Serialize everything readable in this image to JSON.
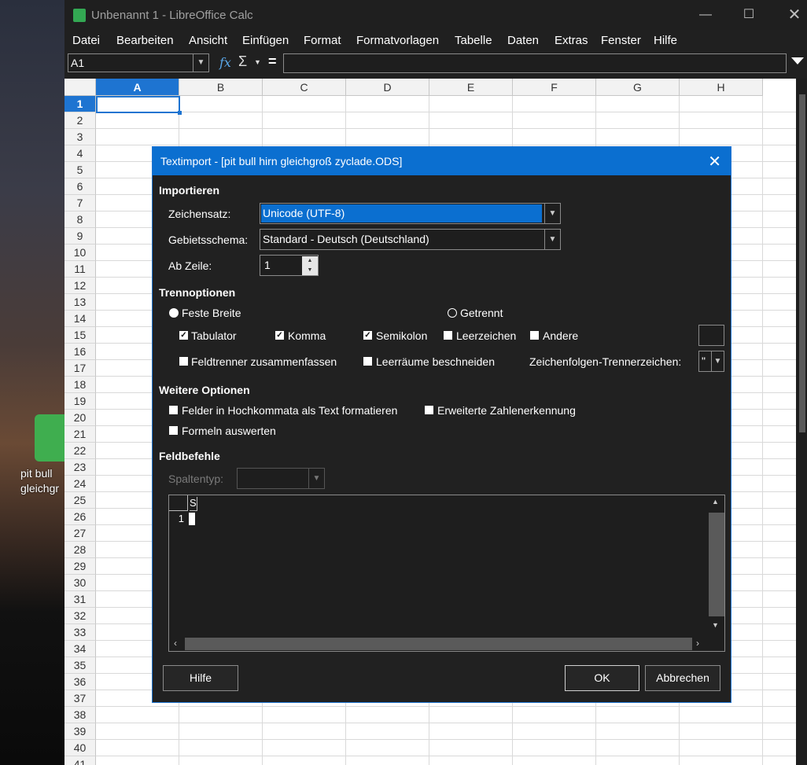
{
  "desktop": {
    "icon_label": "pit bull hirn gleichgroß zyclade.ODS",
    "icon_label_line1": "pit bull",
    "icon_label_line2": "gleichgr"
  },
  "window": {
    "title": "Unbenannt 1 - LibreOffice Calc",
    "minimize_icon": "minimize-icon",
    "maximize_icon": "maximize-icon",
    "close_icon": "close-icon"
  },
  "menu": [
    "Datei",
    "Bearbeiten",
    "Ansicht",
    "Einfügen",
    "Format",
    "Formatvorlagen",
    "Tabelle",
    "Daten",
    "Extras",
    "Fenster",
    "Hilfe"
  ],
  "formula_bar": {
    "name_box": "A1",
    "fx": "𝑓x",
    "sigma": "Σ",
    "equals": "=",
    "content": ""
  },
  "columns": [
    "A",
    "B",
    "C",
    "D",
    "E",
    "F",
    "G",
    "H"
  ],
  "rows": [
    "1",
    "2",
    "3",
    "4",
    "5",
    "6",
    "7",
    "8",
    "9",
    "10",
    "11",
    "12",
    "13",
    "14",
    "15",
    "16",
    "17",
    "18",
    "19",
    "20",
    "21",
    "22",
    "23",
    "24",
    "25",
    "26",
    "27",
    "28",
    "29",
    "30",
    "31",
    "32",
    "33",
    "34",
    "35",
    "36",
    "37",
    "38",
    "39",
    "40",
    "41"
  ],
  "selected_cell": "A1",
  "dialog": {
    "title": "Textimport - [pit bull hirn gleichgroß zyclade.ODS]",
    "section_import": "Importieren",
    "charset_label": "Zeichensatz:",
    "charset_value": "Unicode (UTF-8)",
    "locale_label": "Gebietsschema:",
    "locale_value": "Standard - Deutsch (Deutschland)",
    "from_row_label": "Ab Zeile:",
    "from_row_value": "1",
    "section_separator": "Trennoptionen",
    "fixed_width": "Feste Breite",
    "separated": "Getrennt",
    "tab": "Tabulator",
    "comma": "Komma",
    "semicolon": "Semikolon",
    "space": "Leerzeichen",
    "other": "Andere",
    "merge_delimiters": "Feldtrenner zusammenfassen",
    "trim_spaces": "Leerräume beschneiden",
    "string_delimiter_label": "Zeichenfolgen-Trennerzeichen:",
    "string_delimiter_value": "\"",
    "section_other": "Weitere Optionen",
    "quoted_as_text": "Felder in Hochkommata als Text formatieren",
    "detect_special": "Erweiterte Zahlenerkennung",
    "evaluate_formulas": "Formeln auswerten",
    "section_fields": "Feldbefehle",
    "column_type_label": "Spaltentyp:",
    "column_type_value": "",
    "preview_header": "S",
    "preview_row": "1",
    "help": "Hilfe",
    "ok": "OK",
    "cancel": "Abbrechen"
  },
  "colors": {
    "accent": "#1e74d1",
    "dialog_bg": "#212121",
    "title_blue": "#0b6fd0"
  }
}
